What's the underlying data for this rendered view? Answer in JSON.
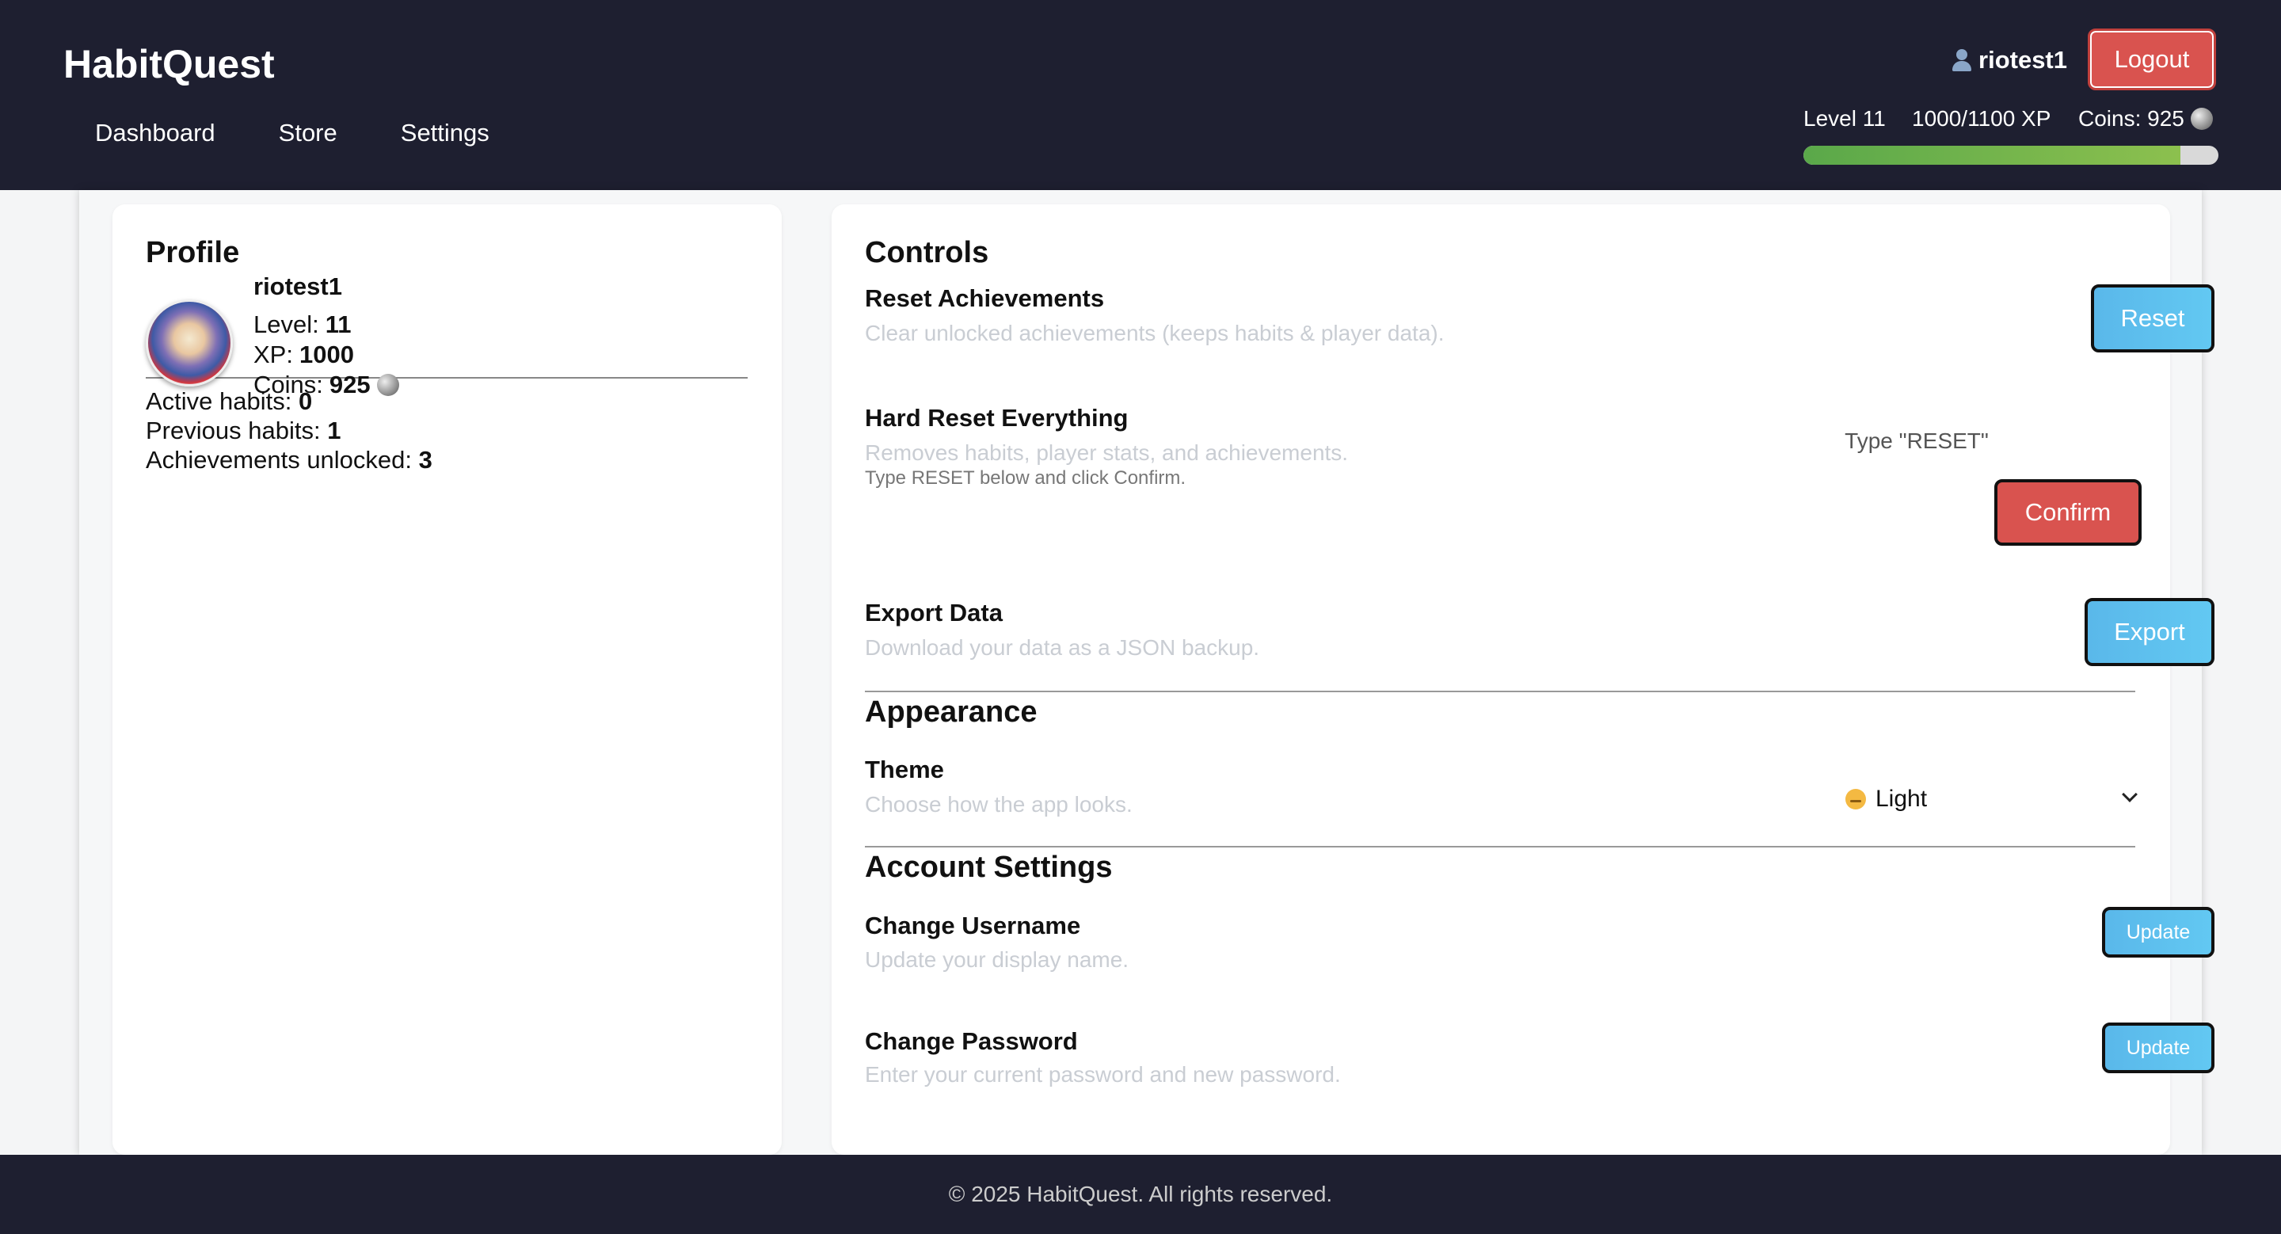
{
  "header": {
    "brand": "HabitQuest",
    "nav": [
      "Dashboard",
      "Store",
      "Settings"
    ],
    "username": "riotest1",
    "logout_label": "Logout",
    "level_text": "Level 11",
    "xp_text": "1000/1100 XP",
    "coins_text": "Coins: 925",
    "xp_progress": 0.909
  },
  "profile": {
    "title": "Profile",
    "username": "riotest1",
    "level_label": "Level:",
    "level_value": "11",
    "xp_label": "XP:",
    "xp_value": "1000",
    "coins_label": "Coins:",
    "coins_value": "925",
    "active_label": "Active habits:",
    "active_value": "0",
    "previous_label": "Previous habits:",
    "previous_value": "1",
    "achievements_label": "Achievements unlocked:",
    "achievements_value": "3"
  },
  "controls": {
    "title": "Controls",
    "reset_ach_title": "Reset Achievements",
    "reset_ach_desc": "Clear unlocked achievements (keeps habits & player data).",
    "reset_label": "Reset",
    "hard_title": "Hard Reset Everything",
    "hard_desc": "Removes habits, player stats, and achievements.",
    "hard_hint": "Type RESET below and click Confirm.",
    "hard_placeholder": "Type \"RESET\"",
    "confirm_label": "Confirm",
    "export_title": "Export Data",
    "export_desc": "Download your data as a JSON backup.",
    "export_label": "Export"
  },
  "appearance": {
    "title": "Appearance",
    "theme_title": "Theme",
    "theme_desc": "Choose how the app looks.",
    "theme_value": "Light"
  },
  "account": {
    "title": "Account Settings",
    "username_title": "Change Username",
    "username_desc": "Update your display name.",
    "password_title": "Change Password",
    "password_desc": "Enter your current password and new password.",
    "update_label": "Update"
  },
  "footer": {
    "text": "© 2025 HabitQuest. All rights reserved."
  },
  "colors": {
    "header_bg": "#1e1f30",
    "accent_blue": "#5ab8ea",
    "danger_red": "#d9534f",
    "xp_green": "#5aa84a"
  }
}
